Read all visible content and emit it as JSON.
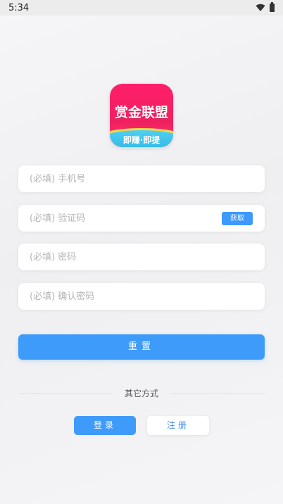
{
  "status_bar": {
    "time": "5:34",
    "icons": [
      "wifi-icon",
      "battery-icon"
    ]
  },
  "logo": {
    "title": "赏金联盟",
    "subtitle": "即赚·即提",
    "colors": {
      "primary": "#f02060",
      "band": "#32b6e8",
      "accent": "#ffd84a"
    }
  },
  "form": {
    "phone": {
      "placeholder": "(必填) 手机号",
      "value": ""
    },
    "code": {
      "placeholder": "(必填) 验证码",
      "value": "",
      "get_code_label": "获取"
    },
    "password": {
      "placeholder": "(必填) 密码",
      "value": ""
    },
    "confirm_password": {
      "placeholder": "(必填) 确认密码",
      "value": ""
    }
  },
  "actions": {
    "reset_label": "重置",
    "other_methods_label": "其它方式",
    "login_label": "登录",
    "register_label": "注册"
  },
  "colors": {
    "accent": "#3f9bfa",
    "background": "#f3f3f5"
  }
}
